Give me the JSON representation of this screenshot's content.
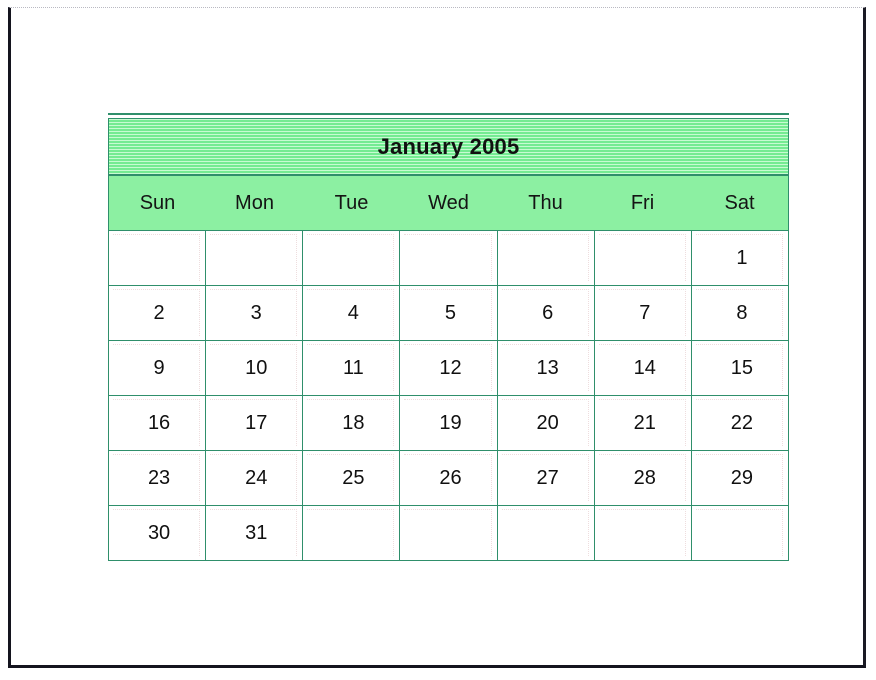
{
  "document": {
    "kind": "printed-calendar-page"
  },
  "calendar": {
    "title": "January 2005",
    "month_name": "January",
    "year": "2005",
    "weekday_headers": [
      "Sun",
      "Mon",
      "Tue",
      "Wed",
      "Thu",
      "Fri",
      "Sat"
    ],
    "weeks": [
      [
        "",
        "",
        "",
        "",
        "",
        "",
        "1"
      ],
      [
        "2",
        "3",
        "4",
        "5",
        "6",
        "7",
        "8"
      ],
      [
        "9",
        "10",
        "11",
        "12",
        "13",
        "14",
        "15"
      ],
      [
        "16",
        "17",
        "18",
        "19",
        "20",
        "21",
        "22"
      ],
      [
        "23",
        "24",
        "25",
        "26",
        "27",
        "28",
        "29"
      ],
      [
        "30",
        "31",
        "",
        "",
        "",
        "",
        ""
      ]
    ],
    "colors": {
      "title_stripe_light": "#c7fbd2",
      "title_stripe_dark": "#74eb92",
      "weekday_header_bg": "#8cf0a2",
      "grid_border": "#2f8f6b",
      "inner_gridline": "#eeddde",
      "day_cell_bg": "#ffffff",
      "text": "#111111",
      "page_frame": "#14141e"
    }
  }
}
